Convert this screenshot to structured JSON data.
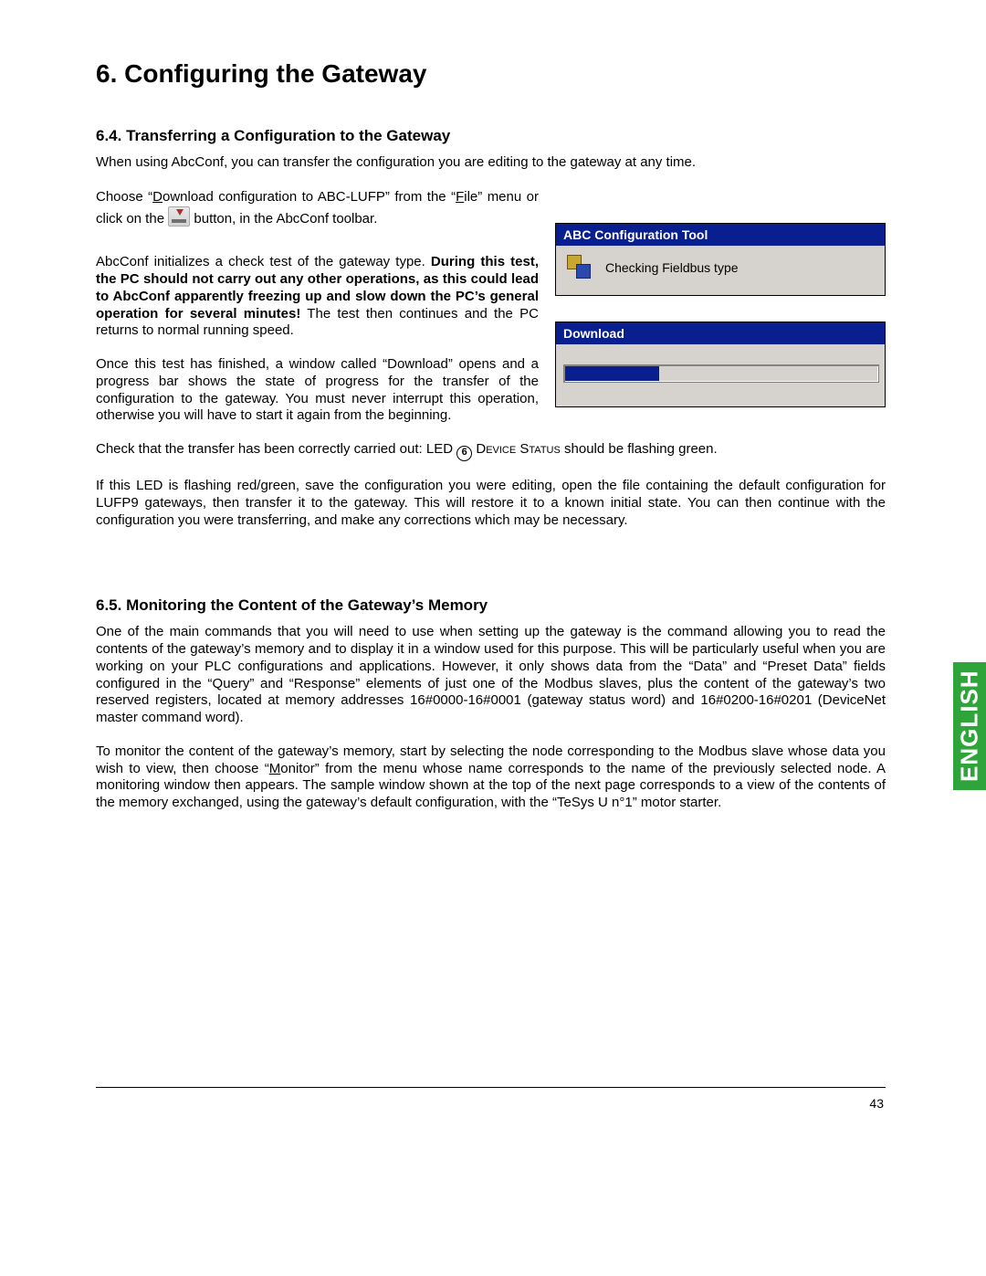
{
  "chapter": {
    "title": "6. Configuring the Gateway"
  },
  "section64": {
    "title": "6.4. Transferring  a Configuration to the Gateway",
    "p1": "When using AbcConf, you can transfer the configuration you are editing to the gateway at any time.",
    "p2a": "Choose “",
    "p2b": "ownload configuration to ABC-LUFP” from the “",
    "p2c": "ile” menu or click on the ",
    "p2d": " button, in the AbcConf toolbar.",
    "p3a": "AbcConf initializes a check test of the gateway type. ",
    "p3bold": "During this test, the PC should not carry out any other operations, as this could lead to AbcConf apparently freezing up and slow down the PC’s general operation for several minutes!",
    "p3b": " The test then continues and the PC returns to normal running speed.",
    "p4": "Once this test has finished, a window called “Download” opens and a progress bar shows the state of progress for the transfer of the configuration to the gateway. You must never interrupt this operation, otherwise you will have to start it again from the beginning.",
    "p5a": "Check that the transfer has been correctly carried out: LED ",
    "p5num": "6",
    "p5b": " D",
    "p5sc": "evice",
    "p5c": " S",
    "p5sc2": "tatus",
    "p5d": " should be flashing green.",
    "p6": "If this LED is flashing red/green, save the configuration you were editing, open the file containing the default configuration for LUFP9 gateways, then transfer it to the gateway. This will restore it to a known initial state. You can then continue with the configuration you were transferring, and make any corrections which may be necessary."
  },
  "section65": {
    "title": "6.5. Monitoring the Content of the Gateway’s Memory",
    "p1": "One of the main commands that you will need to use when setting up the gateway is the command allowing you to read the contents of the gateway’s memory and to display it in a window used for this purpose. This will be particularly useful when you are working on your PLC configurations and applications. However, it only shows data from the “Data” and “Preset Data” fields configured in the “Query” and “Response” elements of just one of the Modbus slaves, plus the content of the gateway’s two reserved registers, located at memory addresses 16#0000-16#0001 (gateway status word) and 16#0200-16#0201 (DeviceNet master command word).",
    "p2a": "To monitor the content of the gateway’s memory, start by selecting the node corresponding to the Modbus slave whose data you wish to view, then choose “",
    "p2b": "onitor” from the menu whose name corresponds to the name of the previously selected node. A monitoring window then appears. The sample window shown at the top of the next page corresponds to a view of the contents of the memory exchanged, using the gateway’s default configuration, with the “TeSys U n°1” motor starter."
  },
  "dialogs": {
    "win1_title": "ABC Configuration Tool",
    "win1_text": "Checking Fieldbus type",
    "win2_title": "Download"
  },
  "menu_letters": {
    "D": "D",
    "F": "F",
    "M": "M"
  },
  "language_tab": "ENGLISH",
  "page_number": "43"
}
